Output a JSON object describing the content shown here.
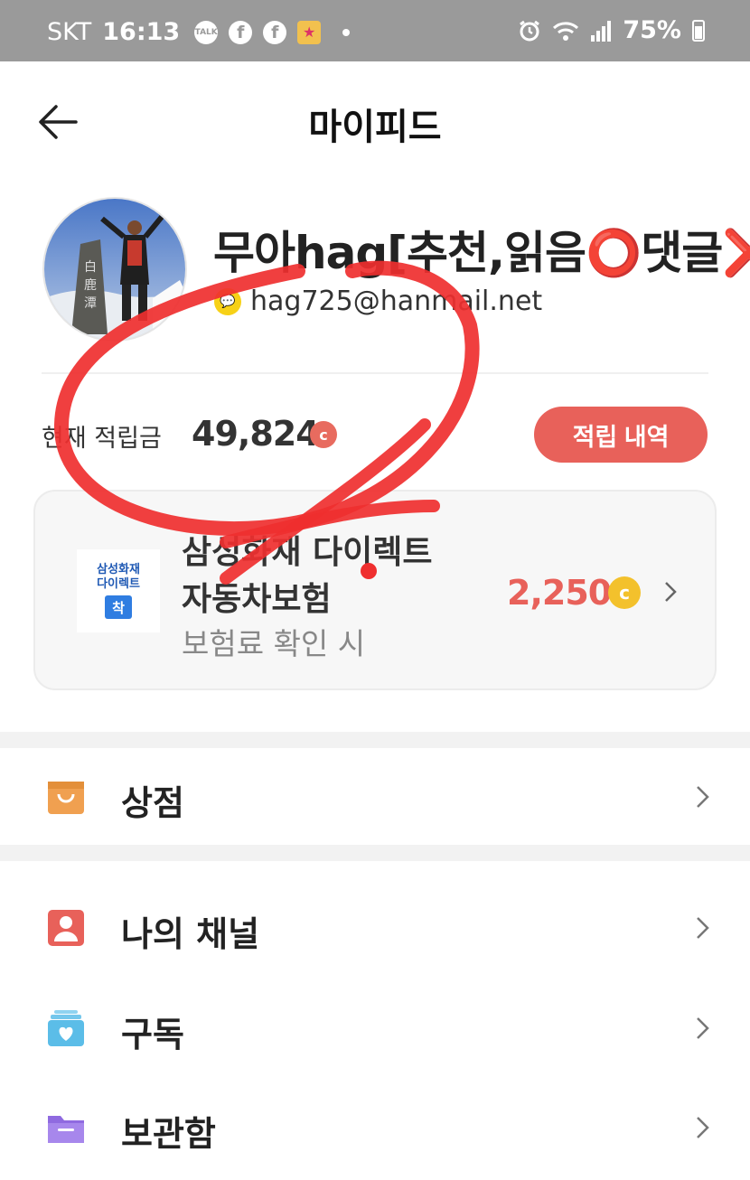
{
  "status_bar": {
    "carrier": "SKT",
    "time": "16:13",
    "talk_icon_label": "TALK",
    "facebook_glyph": "f",
    "battery": "75%"
  },
  "header": {
    "title": "마이피드"
  },
  "profile": {
    "nickname": "무아hag[추천,읽음⭕댓글❌",
    "email": "hag725@hanmail.net"
  },
  "points": {
    "label": "현재 적립금",
    "value": "49,824",
    "coin_glyph": "c",
    "history_button": "적립 내역"
  },
  "ad": {
    "logo_line1": "삼성화재",
    "logo_line2": "다이렉트",
    "logo_badge": "착",
    "title_line1": "삼성화재 다이렉트",
    "title_line2": "자동차보험",
    "subtitle": "보험료 확인 시",
    "reward": "2,250",
    "reward_coin_glyph": "c"
  },
  "menu": [
    {
      "label": "상점",
      "icon": "shop-bag-icon",
      "color": "#f0a050"
    },
    {
      "label": "나의 채널",
      "icon": "person-icon",
      "color": "#e8615a"
    },
    {
      "label": "구독",
      "icon": "heart-stack-icon",
      "color": "#5bbde8"
    },
    {
      "label": "보관함",
      "icon": "folder-icon",
      "color": "#8f6ae0"
    }
  ],
  "colors": {
    "accent": "#e8615a",
    "annotation": "#ef2f2f",
    "status_bar": "#9a9a9a",
    "coin_gold": "#f3c12c"
  }
}
